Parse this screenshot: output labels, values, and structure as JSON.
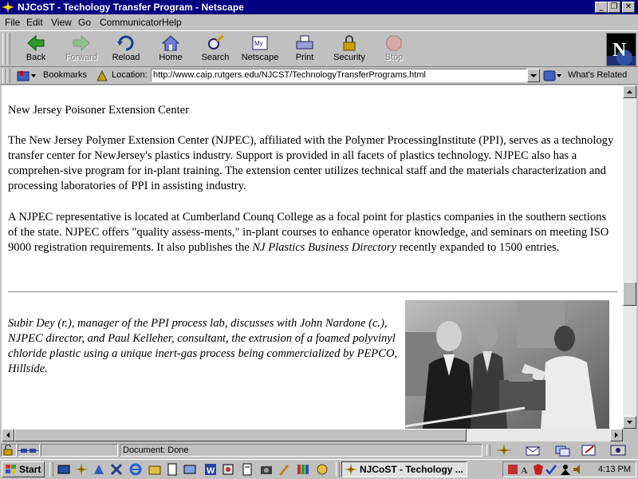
{
  "window": {
    "title": "NJCoST - Techology Transfer Program - Netscape",
    "minimize": "_",
    "maximize": "❐",
    "close": "✕"
  },
  "menu": [
    "File",
    "Edit",
    "View",
    "Go",
    "Communicator",
    "Help"
  ],
  "toolbar": {
    "back": "Back",
    "forward": "Forward",
    "reload": "Reload",
    "home": "Home",
    "search": "Search",
    "netscape": "Netscape",
    "print": "Print",
    "security": "Security",
    "stop": "Stop"
  },
  "location_bar": {
    "bookmarks": "Bookmarks",
    "location_label": "Location:",
    "url": "http://www.caip.rutgers.edu/NJCST/TechnologyTransferPrograms.html",
    "whats_related": "What's Related"
  },
  "content": {
    "heading": "New Jersey Poisoner Extension Center",
    "para1": "The New Jersey Polymer Extension Center (NJPEC), affiliated with the Polymer ProcessingInstitute (PPI), serves as a technology transfer center for NewJersey's plastics industry. Support is provided in all facets of plastics technology. NJPEC also has a comprehen-sive program for in-plant training. The extension center utilizes technical staff and the materials characterization and processing laboratories of PPI in assisting industry.",
    "para2_before": "A NJPEC representative is located at Cumberland Counq College as a focal point for plastics companies in the southern sections of the state. NJPEC offers \"quality assess-ments,\" in-plant courses to enhance operator knowledge, and seminars on meeting ISO 9000 registration requirements. It also publishes the ",
    "para2_italic": "NJ Plastics Business Directory",
    "para2_after": " recently expanded to 1500 entries.",
    "caption": "Subir Dey (r.), manager of the PPI process lab, discusses with John Nardone (c.), NJPEC director, and Paul Kelleher, consultant, the extrusion of a foamed polyvinyl chloride plastic using a unique inert-gas process being commercialized by PEPCO, Hillside."
  },
  "status": {
    "text": "Document: Done"
  },
  "taskbar": {
    "start": "Start",
    "task": "NJCoST - Techology ...",
    "clock": "4:13 PM"
  },
  "colors": {
    "titlebar": "#000080",
    "chrome": "#c0c0c0",
    "page_bg": "#ffffff"
  }
}
